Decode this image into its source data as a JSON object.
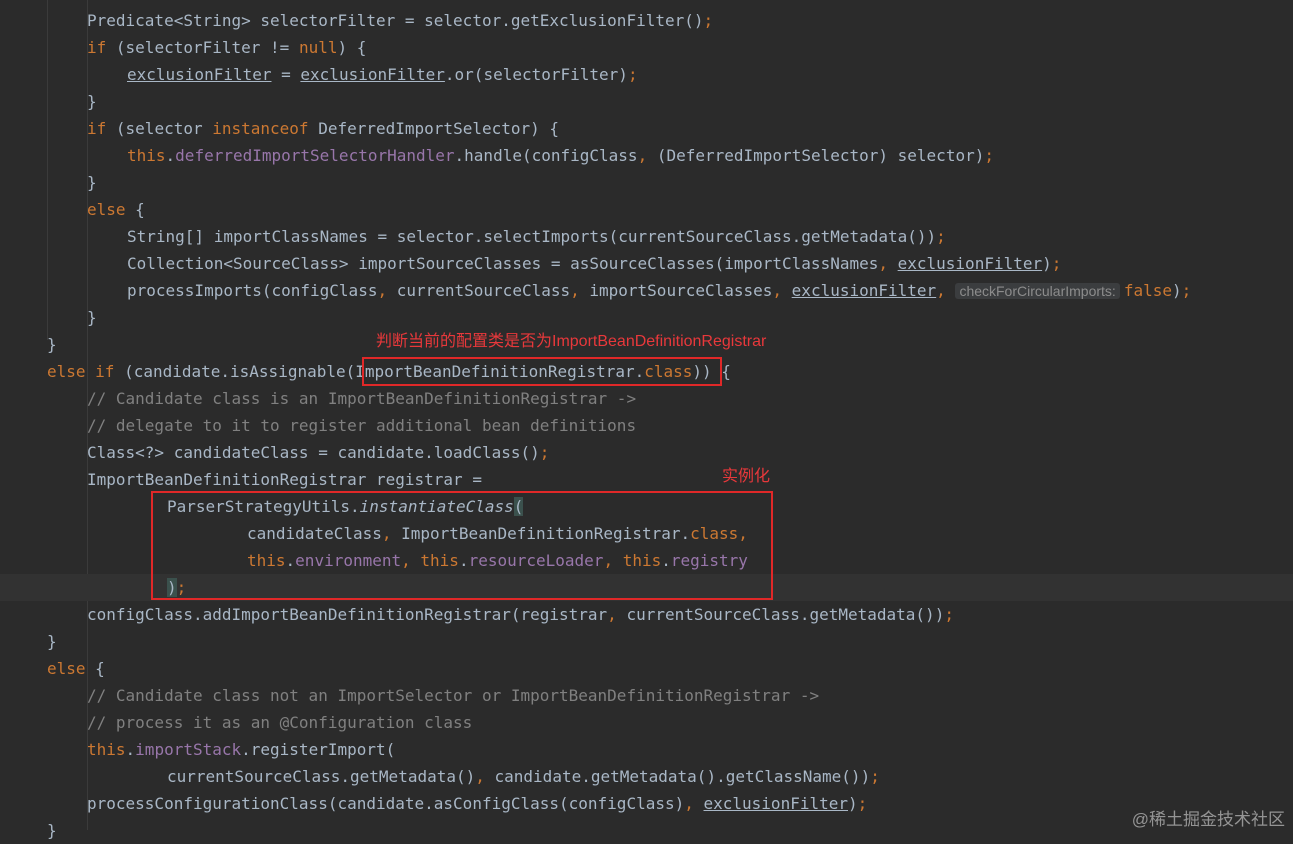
{
  "editor": {
    "lines": [
      {
        "indent": 2,
        "tokens": [
          {
            "t": "Predicate<String> selectorFilter = selector.getExclusionFilter()"
          },
          {
            "t": ";",
            "c": "kw"
          }
        ]
      },
      {
        "indent": 2,
        "tokens": [
          {
            "t": "if ",
            "c": "kw"
          },
          {
            "t": "(selectorFilter != "
          },
          {
            "t": "null",
            "c": "kw"
          },
          {
            "t": ") {"
          }
        ]
      },
      {
        "indent": 3,
        "tokens": [
          {
            "t": "exclusionFilter",
            "c": "ul"
          },
          {
            "t": " = "
          },
          {
            "t": "exclusionFilter",
            "c": "ul"
          },
          {
            "t": ".or(selectorFilter)"
          },
          {
            "t": ";",
            "c": "kw"
          }
        ]
      },
      {
        "indent": 2,
        "tokens": [
          {
            "t": "}"
          }
        ]
      },
      {
        "indent": 2,
        "tokens": [
          {
            "t": "if ",
            "c": "kw"
          },
          {
            "t": "(selector "
          },
          {
            "t": "instanceof ",
            "c": "kw"
          },
          {
            "t": "DeferredImportSelector) {"
          }
        ]
      },
      {
        "indent": 3,
        "tokens": [
          {
            "t": "this",
            "c": "kw"
          },
          {
            "t": "."
          },
          {
            "t": "deferredImportSelectorHandler",
            "c": "fld"
          },
          {
            "t": ".handle(configClass"
          },
          {
            "t": ", ",
            "c": "kw"
          },
          {
            "t": "(DeferredImportSelector) selector)"
          },
          {
            "t": ";",
            "c": "kw"
          }
        ]
      },
      {
        "indent": 2,
        "tokens": [
          {
            "t": "}"
          }
        ]
      },
      {
        "indent": 2,
        "tokens": [
          {
            "t": "else ",
            "c": "kw"
          },
          {
            "t": "{"
          }
        ]
      },
      {
        "indent": 3,
        "tokens": [
          {
            "t": "String[] importClassNames = selector.selectImports(currentSourceClass.getMetadata())"
          },
          {
            "t": ";",
            "c": "kw"
          }
        ]
      },
      {
        "indent": 3,
        "tokens": [
          {
            "t": "Collection<SourceClass> importSourceClasses = asSourceClasses(importClassNames"
          },
          {
            "t": ", ",
            "c": "kw"
          },
          {
            "t": "exclusionFilter",
            "c": "ul"
          },
          {
            "t": ")"
          },
          {
            "t": ";",
            "c": "kw"
          }
        ]
      },
      {
        "indent": 3,
        "tokens": [
          {
            "t": "processImports(configClass"
          },
          {
            "t": ", ",
            "c": "kw"
          },
          {
            "t": "currentSourceClass"
          },
          {
            "t": ", ",
            "c": "kw"
          },
          {
            "t": "importSourceClasses"
          },
          {
            "t": ", ",
            "c": "kw"
          },
          {
            "t": "exclusionFilter",
            "c": "ul"
          },
          {
            "t": ", ",
            "c": "kw"
          },
          {
            "t": "checkForCircularImports:",
            "c": "hint"
          },
          {
            "t": "false",
            "c": "kw"
          },
          {
            "t": ")"
          },
          {
            "t": ";",
            "c": "kw"
          }
        ]
      },
      {
        "indent": 2,
        "tokens": [
          {
            "t": "}"
          }
        ]
      },
      {
        "indent": 1,
        "tokens": [
          {
            "t": "}"
          }
        ]
      },
      {
        "indent": 1,
        "tokens": [
          {
            "t": "else if ",
            "c": "kw"
          },
          {
            "t": "(candidate.isAssignable("
          },
          {
            "t": "ImportBeanDefinitionRegistrar."
          },
          {
            "t": "class",
            "c": "kw"
          },
          {
            "t": ")) {"
          }
        ]
      },
      {
        "indent": 2,
        "tokens": [
          {
            "t": "// Candidate class is an ImportBeanDefinitionRegistrar ->",
            "c": "cmt"
          }
        ]
      },
      {
        "indent": 2,
        "tokens": [
          {
            "t": "// delegate to it to register additional bean definitions",
            "c": "cmt"
          }
        ]
      },
      {
        "indent": 2,
        "tokens": [
          {
            "t": "Class<?> candidateClass = candidate.loadClass()"
          },
          {
            "t": ";",
            "c": "kw"
          }
        ]
      },
      {
        "indent": 2,
        "tokens": [
          {
            "t": "ImportBeanDefinitionRegistrar registrar ="
          }
        ]
      },
      {
        "indent": 4,
        "tokens": [
          {
            "t": "ParserStrategyUtils."
          },
          {
            "t": "instantiateClass",
            "c": "ital"
          },
          {
            "t": "(",
            "c": "paren"
          }
        ]
      },
      {
        "indent": 6,
        "tokens": [
          {
            "t": "candidateClass"
          },
          {
            "t": ", ",
            "c": "kw"
          },
          {
            "t": "ImportBeanDefinitionRegistrar."
          },
          {
            "t": "class",
            "c": "kw"
          },
          {
            "t": ",",
            "c": "kw"
          }
        ]
      },
      {
        "indent": 6,
        "tokens": [
          {
            "t": "this",
            "c": "kw"
          },
          {
            "t": "."
          },
          {
            "t": "environment",
            "c": "fld"
          },
          {
            "t": ", ",
            "c": "kw"
          },
          {
            "t": "this",
            "c": "kw"
          },
          {
            "t": "."
          },
          {
            "t": "resourceLoader",
            "c": "fld"
          },
          {
            "t": ", ",
            "c": "kw"
          },
          {
            "t": "this",
            "c": "kw"
          },
          {
            "t": "."
          },
          {
            "t": "registry",
            "c": "fld"
          }
        ]
      },
      {
        "indent": 4,
        "current": true,
        "tokens": [
          {
            "t": ")",
            "c": "paren"
          },
          {
            "t": ";",
            "c": "kw"
          }
        ]
      },
      {
        "indent": 2,
        "tokens": [
          {
            "t": "configClass.addImportBeanDefinitionRegistrar(registrar"
          },
          {
            "t": ", ",
            "c": "kw"
          },
          {
            "t": "currentSourceClass.getMetadata())"
          },
          {
            "t": ";",
            "c": "kw"
          }
        ]
      },
      {
        "indent": 1,
        "tokens": [
          {
            "t": "}"
          }
        ]
      },
      {
        "indent": 1,
        "tokens": [
          {
            "t": "else ",
            "c": "kw"
          },
          {
            "t": "{"
          }
        ]
      },
      {
        "indent": 2,
        "tokens": [
          {
            "t": "// Candidate class not an ImportSelector or ImportBeanDefinitionRegistrar ->",
            "c": "cmt"
          }
        ]
      },
      {
        "indent": 2,
        "tokens": [
          {
            "t": "// process it as an @Configuration class",
            "c": "cmt"
          }
        ]
      },
      {
        "indent": 2,
        "tokens": [
          {
            "t": "this",
            "c": "kw"
          },
          {
            "t": "."
          },
          {
            "t": "importStack",
            "c": "fld"
          },
          {
            "t": ".registerImport("
          }
        ]
      },
      {
        "indent": 4,
        "tokens": [
          {
            "t": "currentSourceClass.getMetadata()"
          },
          {
            "t": ", ",
            "c": "kw"
          },
          {
            "t": "candidate.getMetadata().getClassName())"
          },
          {
            "t": ";",
            "c": "kw"
          }
        ]
      },
      {
        "indent": 2,
        "tokens": [
          {
            "t": "processConfigurationClass(candidate.asConfigClass(configClass)"
          },
          {
            "t": ", ",
            "c": "kw"
          },
          {
            "t": "exclusionFilter",
            "c": "ul"
          },
          {
            "t": ")"
          },
          {
            "t": ";",
            "c": "kw"
          }
        ]
      },
      {
        "indent": 1,
        "tokens": [
          {
            "t": "}"
          }
        ]
      }
    ]
  },
  "annotations": {
    "registrar_check": "判断当前的配置类是否为ImportBeanDefinitionRegistrar",
    "instantiate": "实例化"
  },
  "watermark": "@稀土掘金技术社区",
  "colors": {
    "background": "#2b2b2b",
    "text": "#a9b7c6",
    "keyword": "#cc7832",
    "field": "#9876aa",
    "comment": "#808080",
    "annotation": "#e02828"
  }
}
